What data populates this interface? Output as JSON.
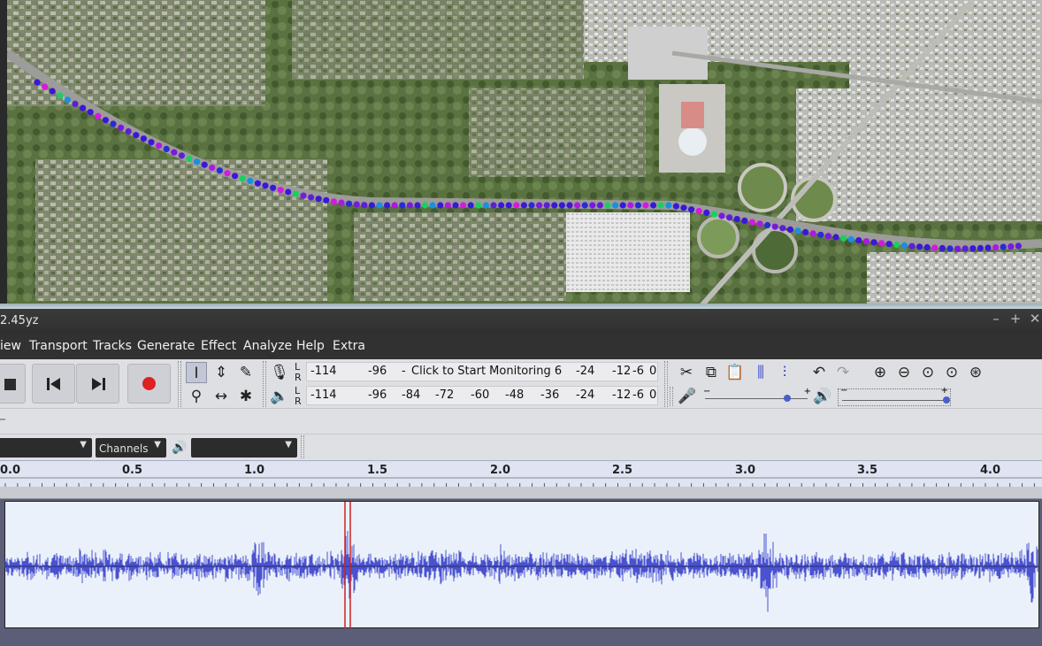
{
  "window": {
    "title": "2.45yz",
    "minimize_icon": "minimize-icon",
    "maximize_icon": "maximize-icon",
    "close_icon": "close-icon"
  },
  "menu": [
    "iew",
    "Transport",
    "Tracks",
    "Generate",
    "Effect",
    "Analyze",
    "Help",
    "Extra"
  ],
  "transport": [
    "stop-icon",
    "skip-to-start-icon",
    "skip-to-end-icon",
    "record-icon"
  ],
  "record_meter": {
    "channels": "L R",
    "ticks": [
      "-114",
      "-96",
      "-",
      "Click to Start Monitoring 6",
      "-24",
      "-12",
      "-6",
      "0"
    ]
  },
  "playback_meter": {
    "channels": "L R",
    "ticks": [
      "-114",
      "-96",
      "-84",
      "-72",
      "-60",
      "-48",
      "-36",
      "-24",
      "-12",
      "-6",
      "0"
    ]
  },
  "slider_marks": {
    "minus": "−",
    "plus": "+"
  },
  "device": {
    "channels_label": "Channels"
  },
  "ruler": {
    "labels": [
      "0.0",
      "0.5",
      "1.0",
      "1.5",
      "2.0",
      "2.5",
      "3.0",
      "3.5",
      "4.0"
    ]
  },
  "colors": {
    "waveform": "#4a52d0",
    "playhead": "#cc2222",
    "record": "#dd2222"
  }
}
